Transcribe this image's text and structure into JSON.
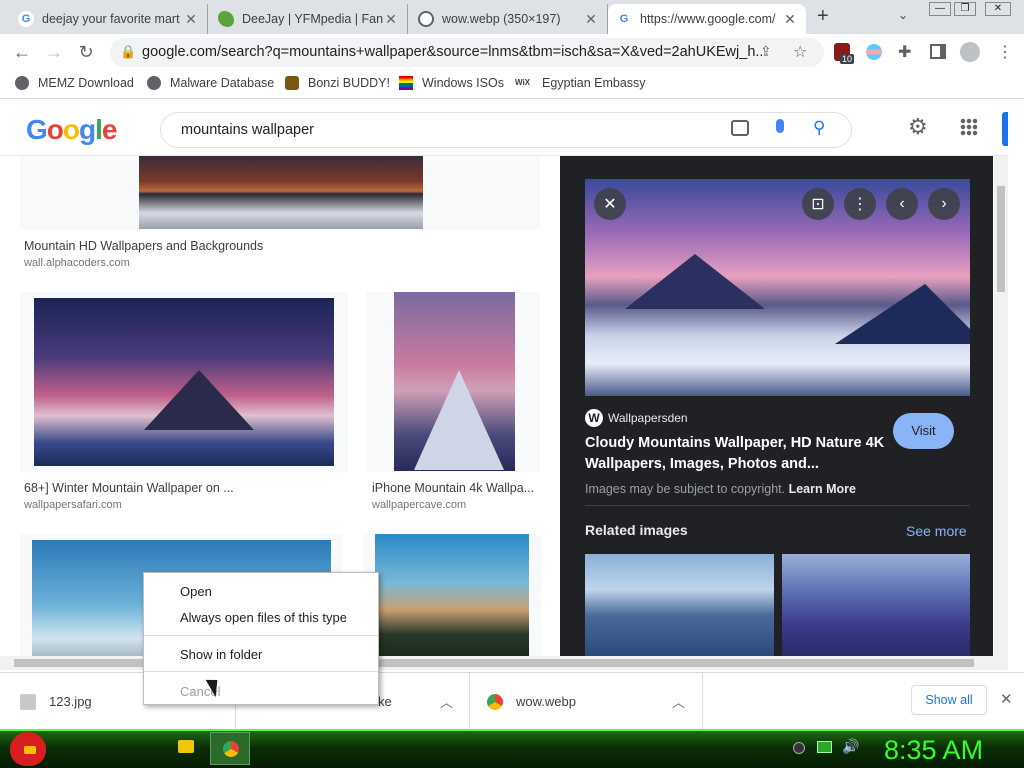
{
  "tabs": [
    {
      "title": "deejay your favorite mart",
      "icon": "google-icon"
    },
    {
      "title": "DeeJay | YFMpedia | Fand",
      "icon": "fandom-icon"
    },
    {
      "title": "wow.webp (350×197)",
      "icon": "globe-icon"
    },
    {
      "title": "https://www.google.com/",
      "icon": "google-icon"
    }
  ],
  "toolbar": {
    "url": "google.com/search?q=mountains+wallpaper&source=lnms&tbm=isch&sa=X&ved=2ahUKEwj_h...",
    "extension_badge": "10"
  },
  "bookmarks": [
    {
      "label": "MEMZ Download"
    },
    {
      "label": "Malware Database"
    },
    {
      "label": "Bonzi BUDDY!"
    },
    {
      "label": "Windows ISOs"
    },
    {
      "label": "Egyptian Embassy"
    }
  ],
  "google": {
    "logo": "Google",
    "query": "mountains wallpaper"
  },
  "results": [
    {
      "title": "Mountain HD Wallpapers and Backgrounds",
      "source": "wall.alphacoders.com"
    },
    {
      "title": "68+] Winter Mountain Wallpaper on ...",
      "source": "wallpapersafari.com"
    },
    {
      "title": "iPhone Mountain 4k Wallpa...",
      "source": "wallpapercave.com"
    }
  ],
  "panel": {
    "site": "Wallpapersden",
    "title": "Cloudy Mountains Wallpaper, HD Nature 4K Wallpapers, Images, Photos and...",
    "visit": "Visit",
    "copyright": "Images may be subject to copyright.",
    "learn_more": "Learn More",
    "related": "Related images",
    "see_more": "See more"
  },
  "downloads": [
    {
      "name": "123.jpg"
    },
    {
      "name": "ke"
    },
    {
      "name": "wow.webp"
    }
  ],
  "show_all": "Show all",
  "context_menu": [
    "Open",
    "Always open files of this type",
    "Show in folder",
    "Cancel"
  ],
  "taskbar": {
    "clock": "8:35 AM"
  },
  "colors": {
    "accent_blue": "#1a73e8",
    "panel_bg": "#202124",
    "visit_btn": "#8ab4f8",
    "clock": "#34ff2a"
  }
}
